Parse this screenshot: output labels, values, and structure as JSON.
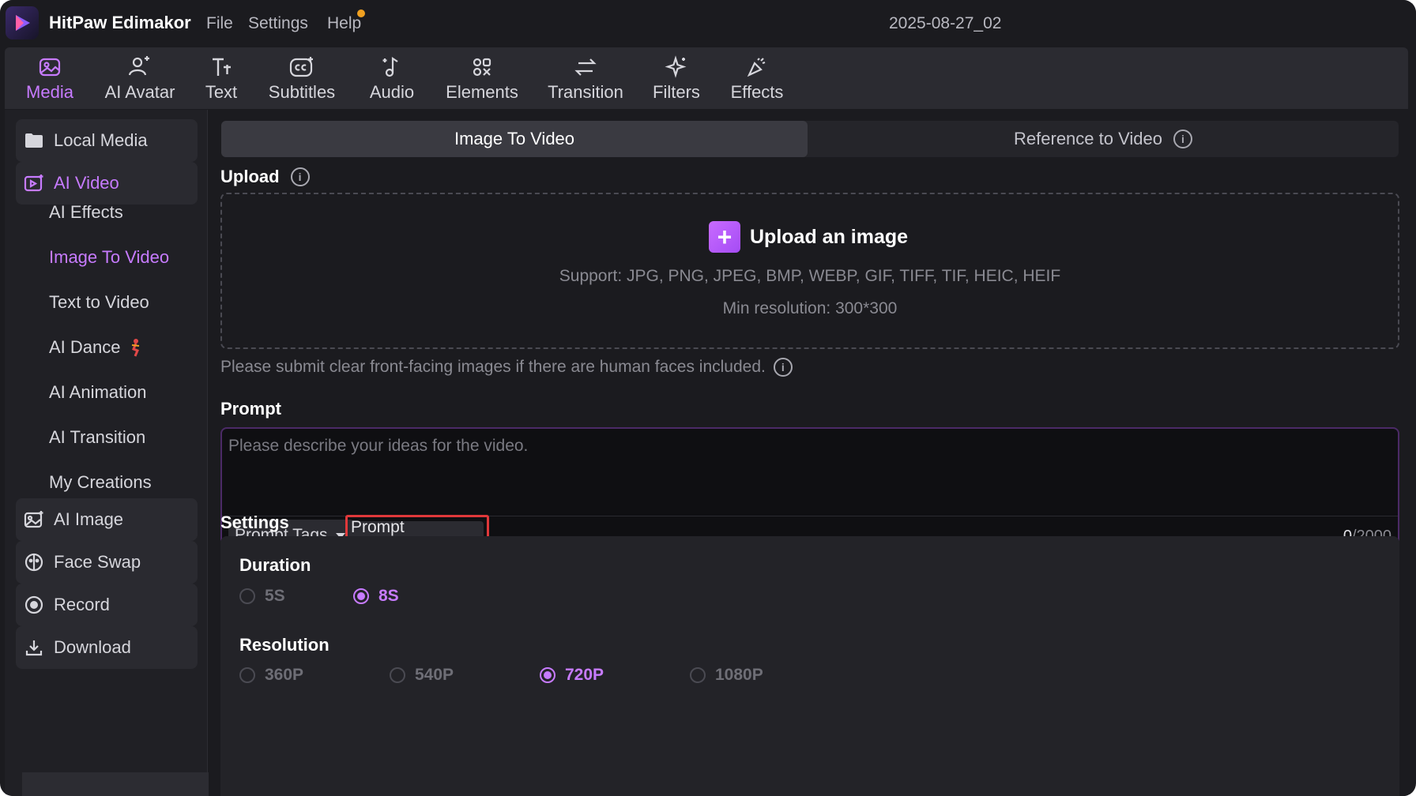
{
  "app": {
    "title": "HitPaw Edimakor",
    "project_name": "2025-08-27_02",
    "accent_color": "#c77bff"
  },
  "menu": {
    "file": "File",
    "settings": "Settings",
    "help": "Help"
  },
  "toolbar": {
    "items": [
      {
        "label": "Media",
        "icon": "media-icon",
        "active": true
      },
      {
        "label": "AI Avatar",
        "icon": "avatar-icon"
      },
      {
        "label": "Text",
        "icon": "text-icon"
      },
      {
        "label": "Subtitles",
        "icon": "subtitles-icon"
      },
      {
        "label": "Audio",
        "icon": "audio-icon"
      },
      {
        "label": "Elements",
        "icon": "elements-icon"
      },
      {
        "label": "Transition",
        "icon": "transition-icon"
      },
      {
        "label": "Filters",
        "icon": "filters-icon"
      },
      {
        "label": "Effects",
        "icon": "effects-icon"
      }
    ]
  },
  "sidebar": {
    "local_media": "Local Media",
    "ai_video": "AI Video",
    "sub_items": [
      "AI Effects",
      "Image To Video",
      "Text to Video",
      "AI Dance",
      "AI Animation",
      "AI Transition",
      "My Creations"
    ],
    "active_sub": "Image To Video",
    "ai_image": "AI Image",
    "face_swap": "Face Swap",
    "record": "Record",
    "download": "Download"
  },
  "tabs": {
    "active": "Image To Video",
    "other": "Reference to Video"
  },
  "upload": {
    "label": "Upload",
    "title": "Upload an image",
    "support": "Support: JPG, PNG, JPEG, BMP, WEBP, GIF, TIFF, TIF, HEIC, HEIF",
    "min_resolution": "Min resolution: 300*300",
    "face_note": "Please submit clear front-facing images if there are human faces included."
  },
  "prompt": {
    "label": "Prompt",
    "placeholder": "Please describe your ideas for the video.",
    "value": "",
    "tags_button": "Prompt Tags",
    "generator_button": "Prompt Generator",
    "count": "0",
    "max": "/2000"
  },
  "settings": {
    "label": "Settings",
    "duration": {
      "label": "Duration",
      "options": [
        "5S",
        "8S"
      ],
      "selected": "8S"
    },
    "resolution": {
      "label": "Resolution",
      "options": [
        "360P",
        "540P",
        "720P",
        "1080P"
      ],
      "selected": "720P"
    }
  }
}
